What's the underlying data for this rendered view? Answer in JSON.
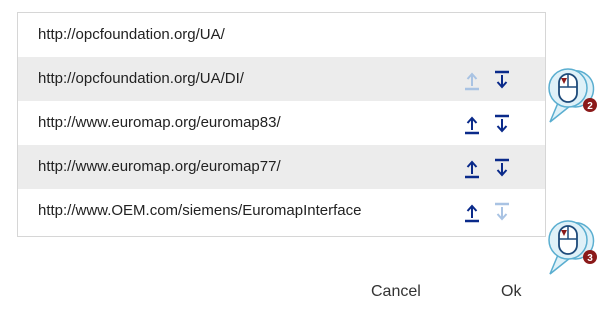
{
  "list": {
    "rows": [
      {
        "url": "http://opcfoundation.org/UA/",
        "move_up": "none",
        "move_down": "none"
      },
      {
        "url": "http://opcfoundation.org/UA/DI/",
        "move_up": "disabled",
        "move_down": "enabled"
      },
      {
        "url": "http://www.euromap.org/euromap83/",
        "move_up": "enabled",
        "move_down": "enabled"
      },
      {
        "url": "http://www.euromap.org/euromap77/",
        "move_up": "enabled",
        "move_down": "enabled"
      },
      {
        "url": "http://www.OEM.com/siemens/EuromapInterface",
        "move_up": "enabled",
        "move_down": "disabled"
      }
    ],
    "icons": {
      "up": "move-up-icon",
      "down": "move-down-icon"
    }
  },
  "callouts": [
    {
      "number": "2",
      "icon": "mouse-click-icon"
    },
    {
      "number": "3",
      "icon": "mouse-click-icon"
    }
  ],
  "dialog": {
    "cancel_label": "Cancel",
    "ok_label": "Ok"
  },
  "colors": {
    "accent": "#0a2a8a",
    "accent_disabled": "#a9c3e3",
    "row_shaded": "#ececec",
    "callout_fill": "#dff1f8",
    "callout_stroke": "#5aaed0",
    "badge": "#8b1a1a"
  }
}
